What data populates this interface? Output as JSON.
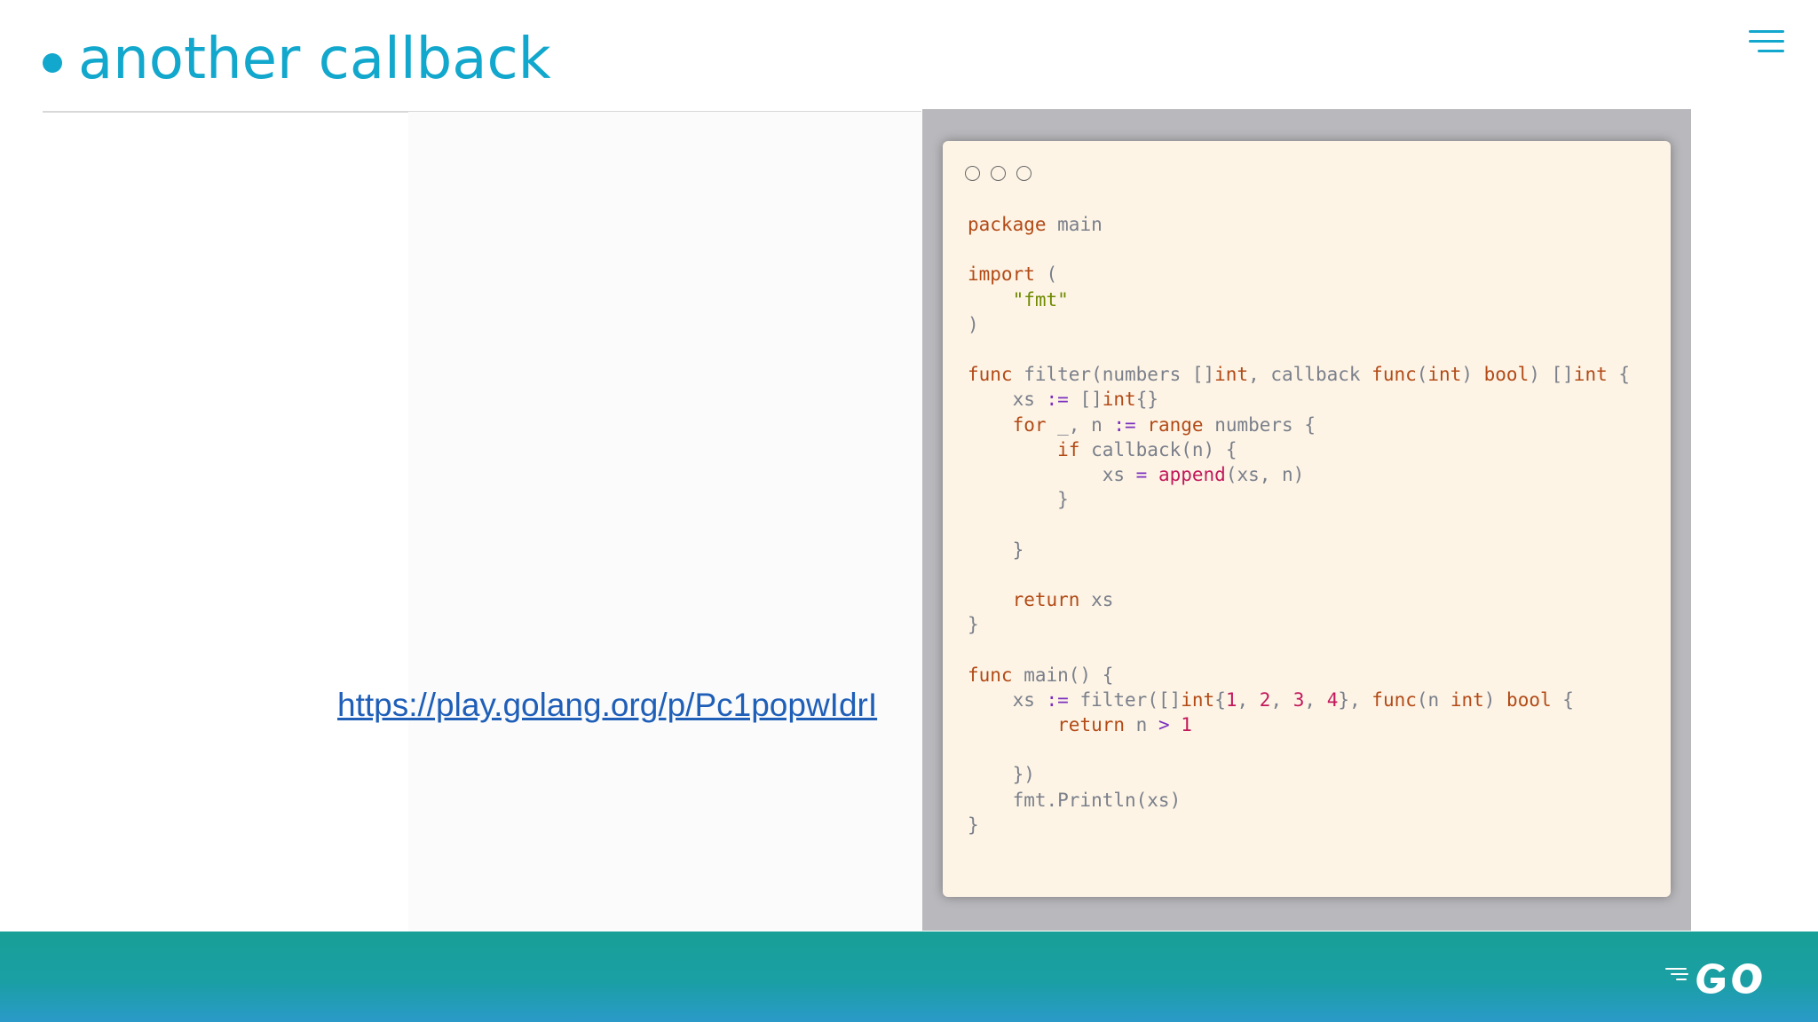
{
  "slide": {
    "title": "another callback",
    "link": "https://play.golang.org/p/Pc1popwIdrI"
  },
  "icons": {
    "menu": "menu-icon",
    "logo": "go-logo"
  },
  "colors": {
    "accent": "#12a7cc",
    "footer": "#1a9fa4",
    "code_background": "#fdf4e6",
    "link": "#1f5fb8"
  },
  "code_lines": [
    "package main",
    "",
    "import (",
    "    \"fmt\"",
    ")",
    "",
    "func filter(numbers []int, callback func(int) bool) []int {",
    "    xs := []int{}",
    "    for _, n := range numbers {",
    "        if callback(n) {",
    "            xs = append(xs, n)",
    "        }",
    "",
    "    }",
    "",
    "    return xs",
    "}",
    "",
    "func main() {",
    "    xs := filter([]int{1, 2, 3, 4}, func(n int) bool {",
    "        return n > 1",
    "",
    "    })",
    "    fmt.Println(xs)",
    "}"
  ]
}
